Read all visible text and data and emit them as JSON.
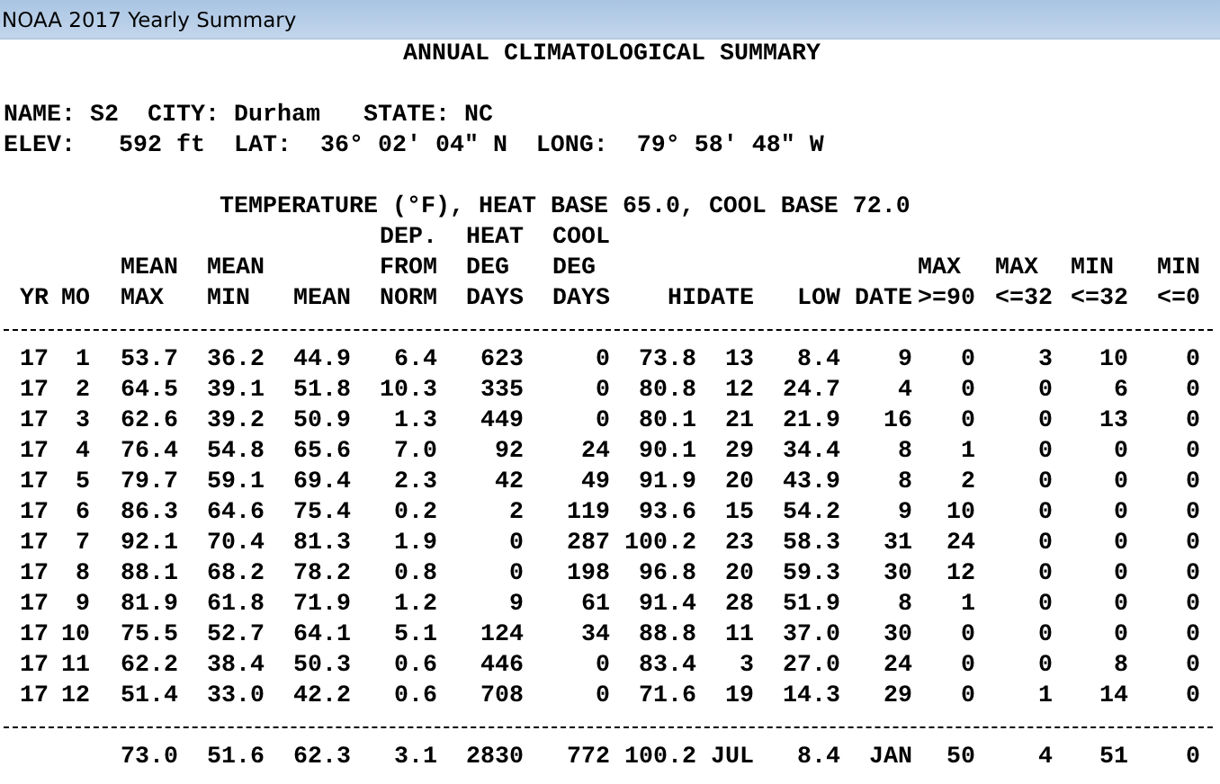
{
  "window": {
    "title": "NOAA 2017 Yearly Summary"
  },
  "report": {
    "title": "ANNUAL CLIMATOLOGICAL SUMMARY",
    "info_lines": [
      "NAME: S2  CITY: Durham   STATE: NC",
      "ELEV:   592 ft  LAT:  36° 02' 04\" N  LONG:  79° 58' 48\" W"
    ],
    "section_title": "TEMPERATURE (°F), HEAT BASE 65.0, COOL BASE 72.0",
    "columns": [
      {
        "lines": [
          "YR"
        ]
      },
      {
        "lines": [
          "MO"
        ]
      },
      {
        "lines": [
          "MEAN",
          "MAX"
        ]
      },
      {
        "lines": [
          "MEAN",
          "MIN"
        ]
      },
      {
        "lines": [
          "MEAN"
        ]
      },
      {
        "lines": [
          "DEP.",
          "FROM",
          "NORM"
        ]
      },
      {
        "lines": [
          "HEAT",
          "DEG",
          "DAYS"
        ]
      },
      {
        "lines": [
          "COOL",
          "DEG",
          "DAYS"
        ]
      },
      {
        "lines": [
          "HI"
        ]
      },
      {
        "lines": [
          "DATE"
        ]
      },
      {
        "lines": [
          "LOW"
        ]
      },
      {
        "lines": [
          "DATE"
        ]
      },
      {
        "lines": [
          "MAX",
          ">=90"
        ]
      },
      {
        "lines": [
          "MAX",
          "<=32"
        ]
      },
      {
        "lines": [
          "MIN",
          "<=32"
        ]
      },
      {
        "lines": [
          "MIN",
          "<=0"
        ]
      }
    ],
    "rows": [
      [
        "17",
        "1",
        "53.7",
        "36.2",
        "44.9",
        "6.4",
        "623",
        "0",
        "73.8",
        "13",
        "8.4",
        "9",
        "0",
        "3",
        "10",
        "0"
      ],
      [
        "17",
        "2",
        "64.5",
        "39.1",
        "51.8",
        "10.3",
        "335",
        "0",
        "80.8",
        "12",
        "24.7",
        "4",
        "0",
        "0",
        "6",
        "0"
      ],
      [
        "17",
        "3",
        "62.6",
        "39.2",
        "50.9",
        "1.3",
        "449",
        "0",
        "80.1",
        "21",
        "21.9",
        "16",
        "0",
        "0",
        "13",
        "0"
      ],
      [
        "17",
        "4",
        "76.4",
        "54.8",
        "65.6",
        "7.0",
        "92",
        "24",
        "90.1",
        "29",
        "34.4",
        "8",
        "1",
        "0",
        "0",
        "0"
      ],
      [
        "17",
        "5",
        "79.7",
        "59.1",
        "69.4",
        "2.3",
        "42",
        "49",
        "91.9",
        "20",
        "43.9",
        "8",
        "2",
        "0",
        "0",
        "0"
      ],
      [
        "17",
        "6",
        "86.3",
        "64.6",
        "75.4",
        "0.2",
        "2",
        "119",
        "93.6",
        "15",
        "54.2",
        "9",
        "10",
        "0",
        "0",
        "0"
      ],
      [
        "17",
        "7",
        "92.1",
        "70.4",
        "81.3",
        "1.9",
        "0",
        "287",
        "100.2",
        "23",
        "58.3",
        "31",
        "24",
        "0",
        "0",
        "0"
      ],
      [
        "17",
        "8",
        "88.1",
        "68.2",
        "78.2",
        "0.8",
        "0",
        "198",
        "96.8",
        "20",
        "59.3",
        "30",
        "12",
        "0",
        "0",
        "0"
      ],
      [
        "17",
        "9",
        "81.9",
        "61.8",
        "71.9",
        "1.2",
        "9",
        "61",
        "91.4",
        "28",
        "51.9",
        "8",
        "1",
        "0",
        "0",
        "0"
      ],
      [
        "17",
        "10",
        "75.5",
        "52.7",
        "64.1",
        "5.1",
        "124",
        "34",
        "88.8",
        "11",
        "37.0",
        "30",
        "0",
        "0",
        "0",
        "0"
      ],
      [
        "17",
        "11",
        "62.2",
        "38.4",
        "50.3",
        "0.6",
        "446",
        "0",
        "83.4",
        "3",
        "27.0",
        "24",
        "0",
        "0",
        "8",
        "0"
      ],
      [
        "17",
        "12",
        "51.4",
        "33.0",
        "42.2",
        "0.6",
        "708",
        "0",
        "71.6",
        "19",
        "14.3",
        "29",
        "0",
        "1",
        "14",
        "0"
      ]
    ],
    "totals": [
      "73.0",
      "51.6",
      "62.3",
      "3.1",
      "2830",
      "772",
      "100.2",
      "JUL",
      "8.4",
      "JAN",
      "50",
      "4",
      "51",
      "0"
    ]
  }
}
